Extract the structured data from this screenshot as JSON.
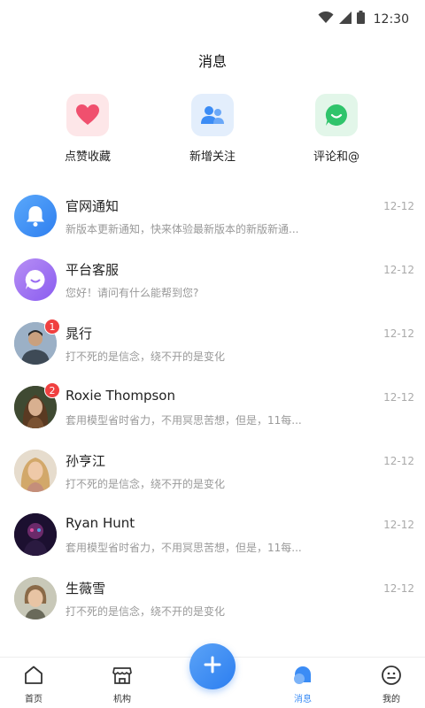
{
  "status_bar": {
    "time": "12:30",
    "icons": [
      "wifi-icon",
      "signal-icon",
      "battery-icon"
    ]
  },
  "header": {
    "title": "消息"
  },
  "quick_actions": [
    {
      "label": "点赞收藏",
      "icon": "heart-icon",
      "color": "#f0506e",
      "bg": "#fde6e8"
    },
    {
      "label": "新增关注",
      "icon": "users-icon",
      "color": "#3b8cf5",
      "bg": "#e3eefc"
    },
    {
      "label": "评论和@",
      "icon": "comment-icon",
      "color": "#2fc46b",
      "bg": "#e2f6e9"
    }
  ],
  "messages": [
    {
      "name": "官网通知",
      "preview": "新版本更新通知，快来体验最新版本的新版新通...",
      "date": "12-12",
      "avatar": "bell-icon",
      "badge": null
    },
    {
      "name": "平台客服",
      "preview": "您好！请问有什么能帮到您?",
      "date": "12-12",
      "avatar": "chat-icon",
      "badge": null
    },
    {
      "name": "晁行",
      "preview": "打不死的是信念，绕不开的是变化",
      "date": "12-12",
      "avatar": "user-photo",
      "badge": "1"
    },
    {
      "name": "Roxie Thompson",
      "preview": "套用模型省时省力，不用冥思苦想，但是，11每...",
      "date": "12-12",
      "avatar": "user-photo",
      "badge": "2"
    },
    {
      "name": "孙亨江",
      "preview": "打不死的是信念，绕不开的是变化",
      "date": "12-12",
      "avatar": "user-photo",
      "badge": null
    },
    {
      "name": "Ryan Hunt",
      "preview": "套用模型省时省力，不用冥思苦想，但是，11每...",
      "date": "12-12",
      "avatar": "user-photo",
      "badge": null
    },
    {
      "name": "生薇雪",
      "preview": "打不死的是信念，绕不开的是变化",
      "date": "12-12",
      "avatar": "user-photo",
      "badge": null
    }
  ],
  "bottom_nav": {
    "items": [
      {
        "label": "首页",
        "icon": "home-icon"
      },
      {
        "label": "机构",
        "icon": "store-icon"
      },
      {
        "label": "消息",
        "icon": "message-icon",
        "active": true
      },
      {
        "label": "我的",
        "icon": "smile-icon"
      }
    ],
    "fab_icon": "plus-icon"
  },
  "colors": {
    "accent": "#3b8cf5",
    "badge": "#f04040"
  }
}
